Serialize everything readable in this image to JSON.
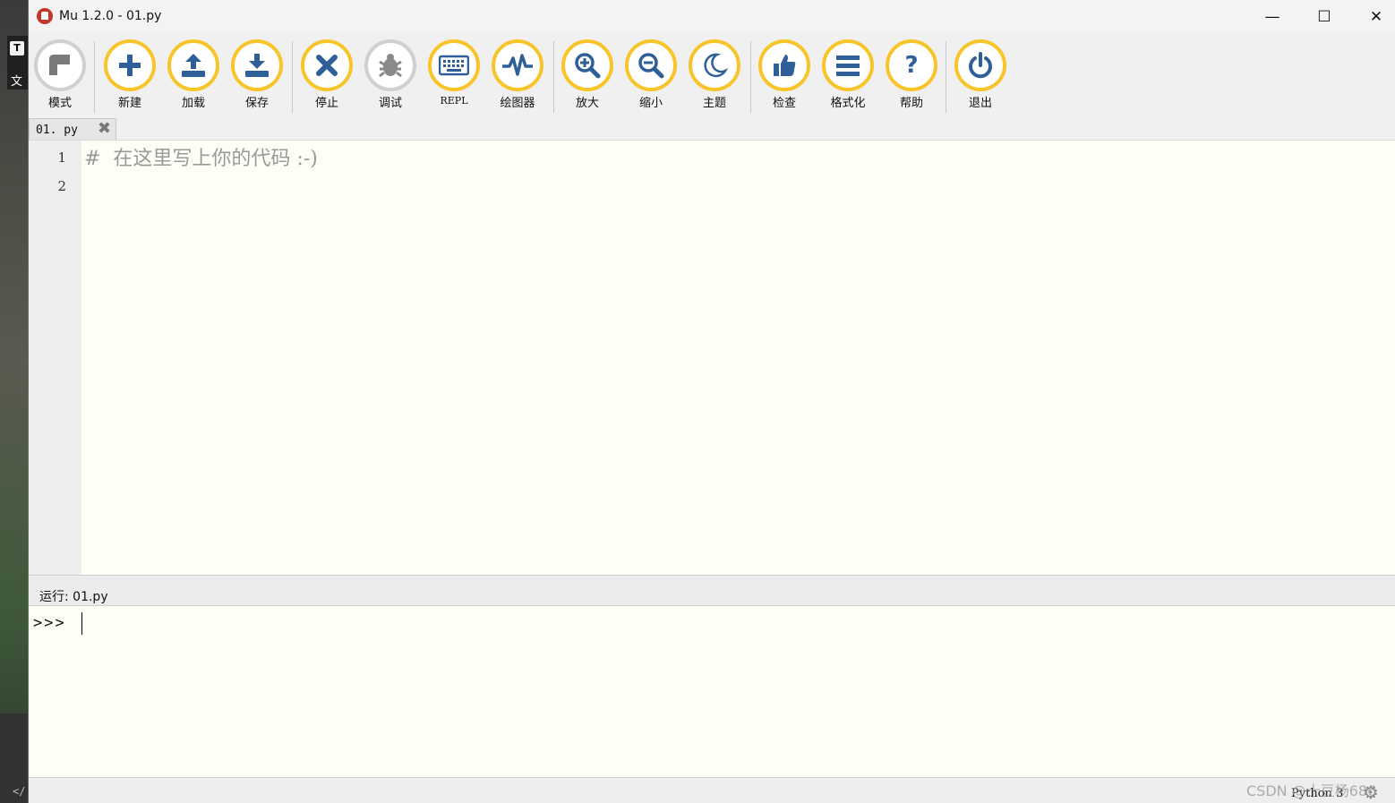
{
  "desktop": {
    "tile_letter": "T",
    "tile_text": "文",
    "code_glyph": "</"
  },
  "window": {
    "title": "Mu 1.2.0 - 01.py",
    "minimize": "—",
    "maximize": "☐",
    "close": "✕"
  },
  "toolbar": {
    "items": [
      {
        "label": "模式",
        "icon": "mode-icon"
      },
      {
        "label": "新建",
        "icon": "plus-icon"
      },
      {
        "label": "加载",
        "icon": "upload-icon"
      },
      {
        "label": "保存",
        "icon": "download-icon"
      },
      {
        "label": "停止",
        "icon": "stop-x-icon"
      },
      {
        "label": "调试",
        "icon": "bug-icon"
      },
      {
        "label": "REPL",
        "icon": "keyboard-icon"
      },
      {
        "label": "绘图器",
        "icon": "pulse-icon"
      },
      {
        "label": "放大",
        "icon": "zoom-in-icon"
      },
      {
        "label": "缩小",
        "icon": "zoom-out-icon"
      },
      {
        "label": "主题",
        "icon": "moon-icon"
      },
      {
        "label": "检查",
        "icon": "thumbs-up-icon"
      },
      {
        "label": "格式化",
        "icon": "lines-icon"
      },
      {
        "label": "帮助",
        "icon": "question-icon"
      },
      {
        "label": "退出",
        "icon": "power-icon"
      }
    ]
  },
  "tabs": [
    {
      "name": "01. py",
      "close": "✖"
    }
  ],
  "editor": {
    "line_numbers": [
      "1",
      "2"
    ],
    "lines": [
      "#  在这里写上你的代码 :-)",
      ""
    ]
  },
  "runbar": {
    "text": "运行: 01.py"
  },
  "repl": {
    "prompt": ">>>"
  },
  "status": {
    "mode": "Python 3",
    "gear": "⚙"
  },
  "watermark": "CSDN @十豆杨686",
  "colors": {
    "accent": "#f7c52a",
    "icon": "#2e5f98",
    "editor_bg": "#fefef6"
  }
}
